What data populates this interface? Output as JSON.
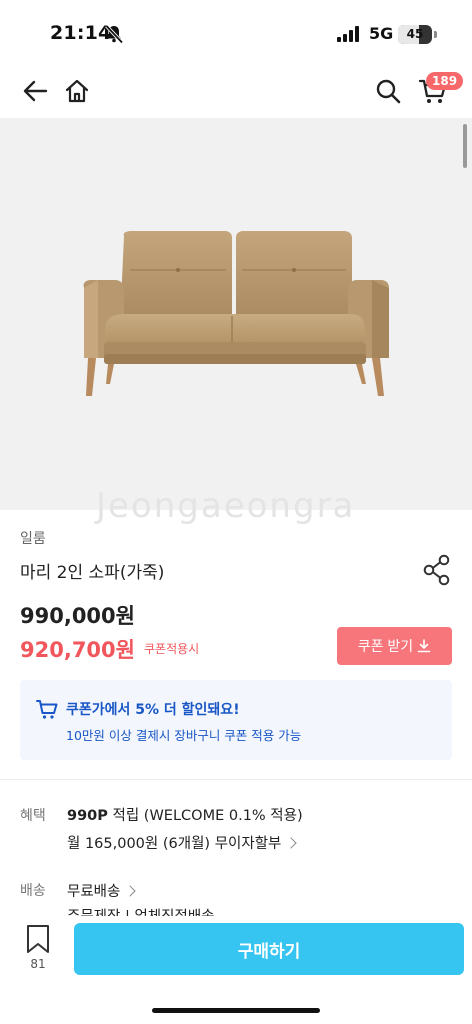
{
  "status_bar": {
    "time": "21:14",
    "network": "5G",
    "battery": "45"
  },
  "nav": {
    "back_icon": "back-arrow-icon",
    "home_icon": "home-icon",
    "search_icon": "search-icon",
    "cart_icon": "cart-icon",
    "cart_count": "189"
  },
  "hero": {
    "watermark": "Jeongaeongra"
  },
  "product": {
    "brand": "일룸",
    "name": "마리 2인 소파(가죽)",
    "price_original": "990,000원",
    "price_coupon": "920,700원",
    "price_coupon_note": "쿠폰적용시",
    "coupon_button": "쿠폰 받기"
  },
  "coupon_banner": {
    "title": "쿠폰가에서 5% 더 할인돼요!",
    "subtitle": "10만원 이상 결제시 장바구니 쿠폰 적용 가능"
  },
  "benefits": {
    "label": "혜택",
    "points": "990P",
    "points_text": "적립 (WELCOME 0.1% 적용)",
    "installment": "월 165,000원 (6개월) 무이자할부"
  },
  "shipping": {
    "label": "배송",
    "value": "무료배송",
    "note": "주문제작 | 업체직접배송"
  },
  "bottom_bar": {
    "wish_count": "81",
    "buy_label": "구매하기"
  },
  "colors": {
    "accent": "#35c5f0",
    "sale": "#f0565c",
    "coupon_button": "#f6767b",
    "banner_text": "#1a57c6",
    "banner_bg": "#f3f7fd"
  }
}
